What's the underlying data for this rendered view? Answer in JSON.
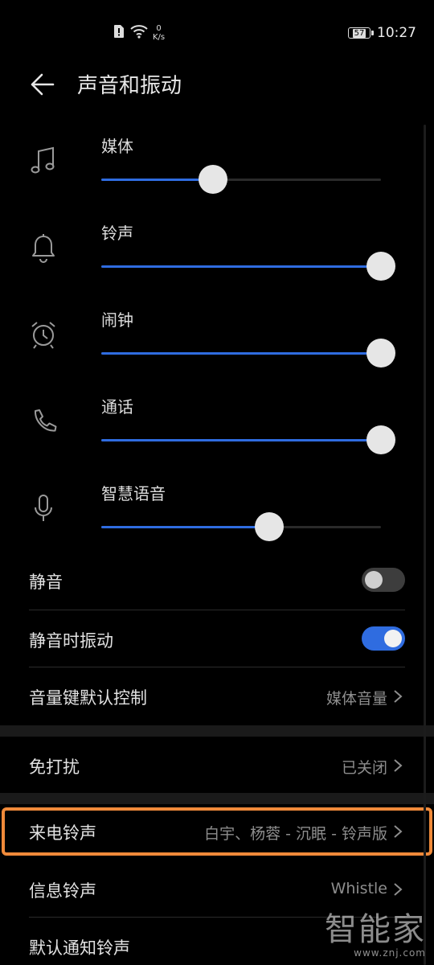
{
  "status": {
    "speed_value": "0",
    "speed_unit": "K/s",
    "battery": "57",
    "time": "10:27"
  },
  "header": {
    "title": "声音和振动"
  },
  "volumes": [
    {
      "label": "媒体",
      "icon": "music-note-icon",
      "level": 0.4
    },
    {
      "label": "铃声",
      "icon": "bell-icon",
      "level": 1.0
    },
    {
      "label": "闹钟",
      "icon": "alarm-clock-icon",
      "level": 1.0
    },
    {
      "label": "通话",
      "icon": "phone-icon",
      "level": 1.0
    },
    {
      "label": "智慧语音",
      "icon": "microphone-icon",
      "level": 0.6
    }
  ],
  "settings": {
    "mute": {
      "label": "静音",
      "on": false
    },
    "vibrate_on_mute": {
      "label": "静音时振动",
      "on": true
    },
    "volume_key_default": {
      "label": "音量键默认控制",
      "value": "媒体音量"
    },
    "do_not_disturb": {
      "label": "免打扰",
      "value": "已关闭"
    },
    "incoming_ringtone": {
      "label": "来电铃声",
      "value": "白宇、杨蓉 - 沉眠 - 铃声版"
    },
    "message_ringtone": {
      "label": "信息铃声",
      "value": "Whistle"
    },
    "default_notification_ringtone": {
      "label": "默认通知铃声"
    }
  },
  "watermark": {
    "main": "智能家",
    "sub": "www.znj.com"
  },
  "colors": {
    "accent": "#2f6ce0",
    "highlight": "#f08a3a",
    "background": "#000000"
  }
}
